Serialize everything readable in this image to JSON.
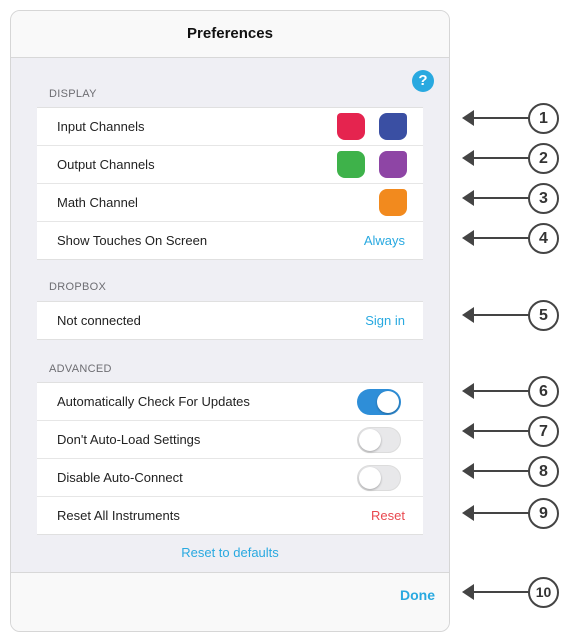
{
  "header": {
    "title": "Preferences"
  },
  "help_label": "?",
  "display": {
    "header": "DISPLAY",
    "input_channels": {
      "label": "Input Channels",
      "colors": [
        "#e5244f",
        "#3a4fa3"
      ]
    },
    "output_channels": {
      "label": "Output Channels",
      "colors": [
        "#3eb24a",
        "#8e45a5"
      ]
    },
    "math_channel": {
      "label": "Math Channel",
      "colors": [
        "#f28a1e"
      ]
    },
    "show_touches": {
      "label": "Show Touches On Screen",
      "value": "Always"
    }
  },
  "dropbox": {
    "header": "DROPBOX",
    "status": "Not connected",
    "action": "Sign in"
  },
  "advanced": {
    "header": "ADVANCED",
    "auto_check_updates": {
      "label": "Automatically Check For Updates",
      "on": true
    },
    "dont_auto_load": {
      "label": "Don't Auto-Load Settings",
      "on": false
    },
    "disable_auto_connect": {
      "label": "Disable Auto-Connect",
      "on": false
    },
    "reset_all": {
      "label": "Reset All Instruments",
      "action": "Reset"
    }
  },
  "reset_defaults": "Reset to defaults",
  "footer": {
    "done": "Done"
  },
  "callouts": [
    "1",
    "2",
    "3",
    "4",
    "5",
    "6",
    "7",
    "8",
    "9",
    "10"
  ],
  "colors": {
    "accent": "#29a9e0",
    "toggle_on": "#2e8ed8",
    "destructive": "#e9484f"
  }
}
